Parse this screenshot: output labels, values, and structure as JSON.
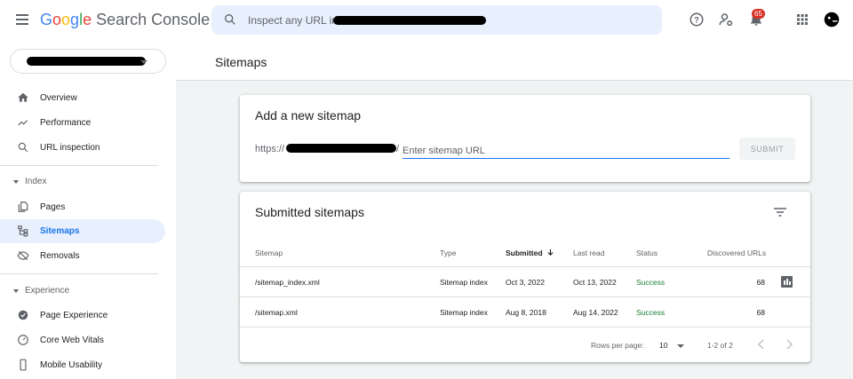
{
  "app": {
    "brand_google": "Google",
    "brand_product": "Search Console"
  },
  "search": {
    "placeholder": "Inspect any URL in"
  },
  "topbar": {
    "notifications_count": "65"
  },
  "sidebar": {
    "items": [
      {
        "label": "Overview",
        "icon": "home-icon"
      },
      {
        "label": "Performance",
        "icon": "trending-icon"
      },
      {
        "label": "URL inspection",
        "icon": "search-icon"
      },
      {
        "label": "Pages",
        "icon": "pages-icon"
      },
      {
        "label": "Sitemaps",
        "icon": "sitemap-icon",
        "active": true
      },
      {
        "label": "Removals",
        "icon": "removals-icon"
      },
      {
        "label": "Page Experience",
        "icon": "page-experience-icon"
      },
      {
        "label": "Core Web Vitals",
        "icon": "speedometer-icon"
      },
      {
        "label": "Mobile Usability",
        "icon": "phone-icon"
      }
    ],
    "sections": [
      "Index",
      "Experience"
    ]
  },
  "page": {
    "title": "Sitemaps"
  },
  "add_sitemap": {
    "title": "Add a new sitemap",
    "prefix_start": "https://",
    "prefix_end": "/",
    "input_placeholder": "Enter sitemap URL",
    "input_value": "",
    "submit_label": "SUBMIT"
  },
  "submitted": {
    "title": "Submitted sitemaps",
    "columns": [
      "Sitemap",
      "Type",
      "Submitted",
      "Last read",
      "Status",
      "Discovered URLs"
    ],
    "rows": [
      {
        "sitemap": "/sitemap_index.xml",
        "type": "Sitemap index",
        "submitted": "Oct 3, 2022",
        "last_read": "Oct 13, 2022",
        "status": "Success",
        "discovered_urls": "68"
      },
      {
        "sitemap": "/sitemap.xml",
        "type": "Sitemap index",
        "submitted": "Aug 8, 2018",
        "last_read": "Aug 14, 2022",
        "status": "Success",
        "discovered_urls": "68"
      }
    ],
    "pagination": {
      "rows_per_page_label": "Rows per page:",
      "rows_per_page_value": "10",
      "range": "1-2 of 2"
    }
  },
  "colors": {
    "accent": "#1a73e8",
    "active_bg": "#e8f0fe",
    "success": "#188038",
    "badge": "#d93025"
  }
}
